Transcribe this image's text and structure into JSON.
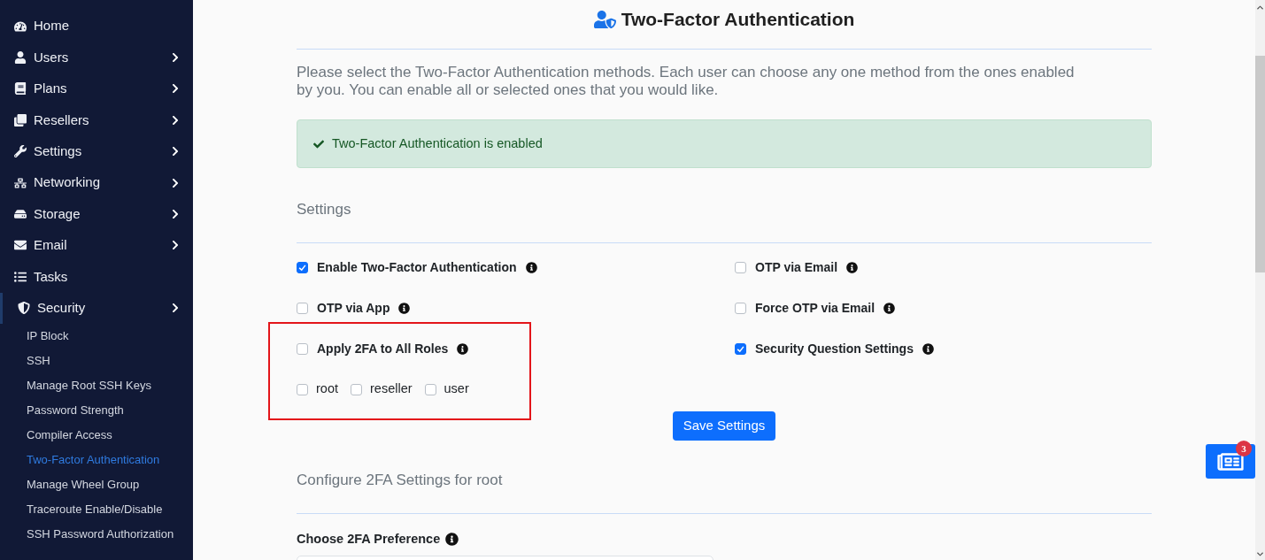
{
  "sidebar": {
    "items": [
      {
        "label": "Home",
        "has_submenu": false,
        "selected": false
      },
      {
        "label": "Users",
        "has_submenu": true,
        "selected": false
      },
      {
        "label": "Plans",
        "has_submenu": true,
        "selected": false
      },
      {
        "label": "Resellers",
        "has_submenu": true,
        "selected": false
      },
      {
        "label": "Settings",
        "has_submenu": true,
        "selected": false
      },
      {
        "label": "Networking",
        "has_submenu": true,
        "selected": false
      },
      {
        "label": "Storage",
        "has_submenu": true,
        "selected": false
      },
      {
        "label": "Email",
        "has_submenu": true,
        "selected": false
      },
      {
        "label": "Tasks",
        "has_submenu": false,
        "selected": false
      },
      {
        "label": "Security",
        "has_submenu": true,
        "selected": true,
        "children": [
          {
            "label": "IP Block",
            "selected": false
          },
          {
            "label": "SSH",
            "selected": false
          },
          {
            "label": "Manage Root SSH Keys",
            "selected": false
          },
          {
            "label": "Password Strength",
            "selected": false
          },
          {
            "label": "Compiler Access",
            "selected": false
          },
          {
            "label": "Two-Factor Authentication",
            "selected": true
          },
          {
            "label": "Manage Wheel Group",
            "selected": false
          },
          {
            "label": "Traceroute Enable/Disable",
            "selected": false
          },
          {
            "label": "SSH Password Authorization",
            "selected": false
          }
        ]
      }
    ]
  },
  "page": {
    "title": "Two-Factor Authentication",
    "intro": "Please select the Two-Factor Authentication methods. Each user can choose any one method from the ones enabled by you. You can enable all or selected ones that you would like.",
    "alert": "Two-Factor Authentication is enabled"
  },
  "settings": {
    "heading": "Settings",
    "left_options": [
      {
        "label": "Enable Two-Factor Authentication",
        "checked": true
      },
      {
        "label": "OTP via App",
        "checked": false
      },
      {
        "label": "Apply 2FA to All Roles",
        "checked": false
      }
    ],
    "right_options": [
      {
        "label": "OTP via Email",
        "checked": false
      },
      {
        "label": "Force OTP via Email",
        "checked": false
      },
      {
        "label": "Security Question Settings",
        "checked": true
      }
    ],
    "roles": [
      {
        "label": "root",
        "checked": false
      },
      {
        "label": "reseller",
        "checked": false
      },
      {
        "label": "user",
        "checked": false
      }
    ],
    "roles_highlighted": true,
    "save_button": "Save Settings"
  },
  "configure": {
    "heading": "Configure 2FA Settings for root",
    "preference_label": "Choose 2FA Preference"
  },
  "news_button": {
    "badge": "3"
  }
}
